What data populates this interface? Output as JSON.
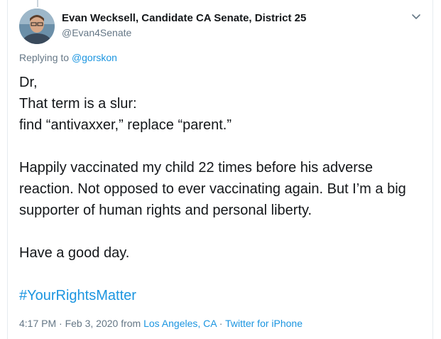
{
  "author": {
    "name": "Evan Wecksell, Candidate CA Senate, District 25",
    "handle": "@Evan4Senate"
  },
  "reply": {
    "prefix": "Replying to",
    "mention": "@gorskon"
  },
  "tweet": {
    "lines": [
      "Dr,",
      "That term is a slur:",
      "find “antivaxxer,” replace “parent.”"
    ],
    "paragraph2": "Happily vaccinated my child 22 times before his adverse reaction. Not opposed to ever vaccinating again. But I’m a big supporter of human rights and personal liberty.",
    "paragraph3": "Have a good day.",
    "hashtag": "#YourRightsMatter"
  },
  "meta": {
    "time": "4:17 PM",
    "sep1": " · ",
    "date": "Feb 3, 2020",
    "from": " from ",
    "location": "Los Angeles, CA",
    "sep2": " · ",
    "source": "Twitter for iPhone"
  },
  "icons": {
    "more": "chevron-down-icon",
    "avatar": "avatar"
  },
  "colors": {
    "text": "#14171a",
    "secondary": "#657786",
    "link": "#1b95e0",
    "border": "#e6ecf0"
  }
}
